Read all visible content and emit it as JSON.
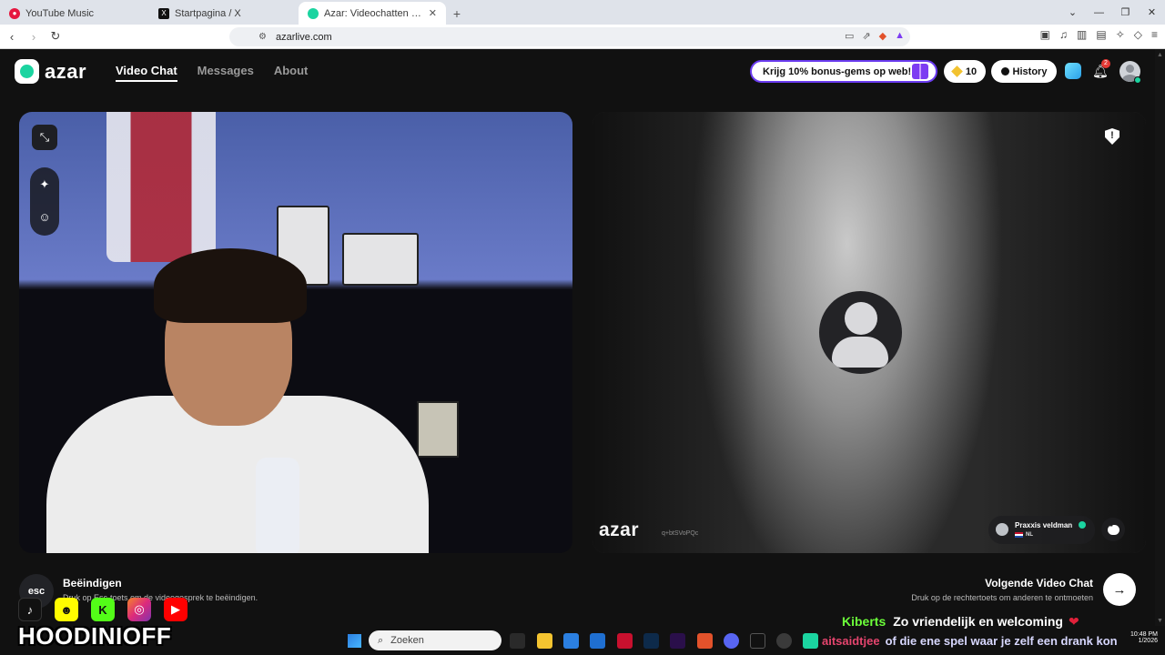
{
  "browser": {
    "tabs": [
      {
        "label": "YouTube Music",
        "icon": "youtube-music-icon",
        "color": "#e5173f"
      },
      {
        "label": "Startpagina / X",
        "icon": "x-icon",
        "color": "#111111"
      },
      {
        "label": "Azar: Videochatten met nieuwe",
        "icon": "azar-icon",
        "color": "#1bd4a0"
      }
    ],
    "url": "azarlive.com"
  },
  "header": {
    "logo_text": "azar",
    "nav": [
      "Video Chat",
      "Messages",
      "About"
    ],
    "promo_label": "Krijg 10% bonus-gems op web!",
    "gems_count": "10",
    "history_label": "History",
    "notification_count": "2"
  },
  "remote": {
    "watermark": "azar",
    "session_id": "q+btSVoPQc",
    "name": "Praxxis veldman",
    "country": "NL"
  },
  "hints": {
    "esc_key": "esc",
    "end_title": "Beëindigen",
    "end_desc": "Druk op Esc-toets om de videogesprek te beëindigen.",
    "next_title": "Volgende Video Chat",
    "next_desc": "Druk op de rechtertoets om anderen te ontmoeten"
  },
  "overlay": {
    "socials": [
      "tiktok-icon",
      "snapchat-icon",
      "kick-icon",
      "instagram-icon",
      "youtube-icon"
    ],
    "streamer": "HOODINIOFF",
    "chat_user": "Kiberts",
    "chat_msg": "Zo vriendelijk en welcoming",
    "ticker_user": "aitsaidtjee",
    "ticker_msg": "of die ene spel waar je zelf een drank kon"
  },
  "taskbar": {
    "search_placeholder": "Zoeken",
    "time": "10:48 PM",
    "date": "1/2026"
  },
  "colors": {
    "accent": "#1bd4a0",
    "promo_border": "#6b3cf0",
    "background": "#111111"
  }
}
